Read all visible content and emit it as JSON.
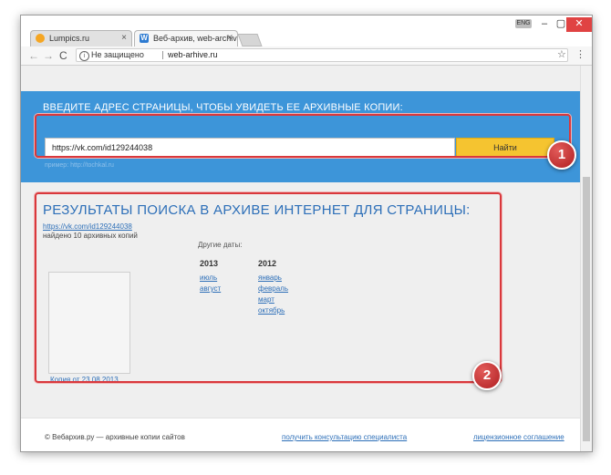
{
  "browser": {
    "tabs": [
      {
        "title": "Lumpics.ru",
        "close": "×"
      },
      {
        "title": "Веб-архив, web-archive",
        "close": "×"
      }
    ],
    "lang": "ENG",
    "window_controls": {
      "minimize": "–",
      "maximize": "▢",
      "close": "✕"
    },
    "address": {
      "secure_label": "Не защищено",
      "url": "web-arhive.ru"
    },
    "nav": {
      "back": "←",
      "forward": "→",
      "reload": "C",
      "star": "☆",
      "menu": "⋮",
      "info": "i"
    }
  },
  "hero": {
    "title": "ВВЕДИТЕ АДРЕС СТРАНИЦЫ, ЧТОБЫ УВИДЕТЬ ЕЕ АРХИВНЫЕ КОПИИ:",
    "input_value": "https://vk.com/id129244038",
    "button_label": "Найти",
    "example": "пример: http://tochkal.ru"
  },
  "results": {
    "title": "РЕЗУЛЬТАТЫ ПОИСКА В АРХИВЕ ИНТЕРНЕТ ДЛЯ СТРАНИЦЫ:",
    "link": "https://vk.com/id129244038",
    "found": "найдено 10 архивных копий",
    "other_dates": "Другие даты:",
    "years": [
      {
        "year": "2013",
        "months": [
          "июль",
          "август"
        ]
      },
      {
        "year": "2012",
        "months": [
          "январь",
          "февраль",
          "март",
          "октябрь"
        ]
      }
    ],
    "copy_link": "Копия от 23.08.2013"
  },
  "annotations": {
    "badge1": "1",
    "badge2": "2"
  },
  "footer": {
    "copyright": "© Вебархив.ру — архивные копии сайтов",
    "consult": "получить консультацию специалиста",
    "license": "лицензионное соглашение"
  },
  "colors": {
    "hero": "#3d95d9",
    "button": "#f5c430",
    "link": "#2d6fb8",
    "frame": "#d9383c"
  }
}
